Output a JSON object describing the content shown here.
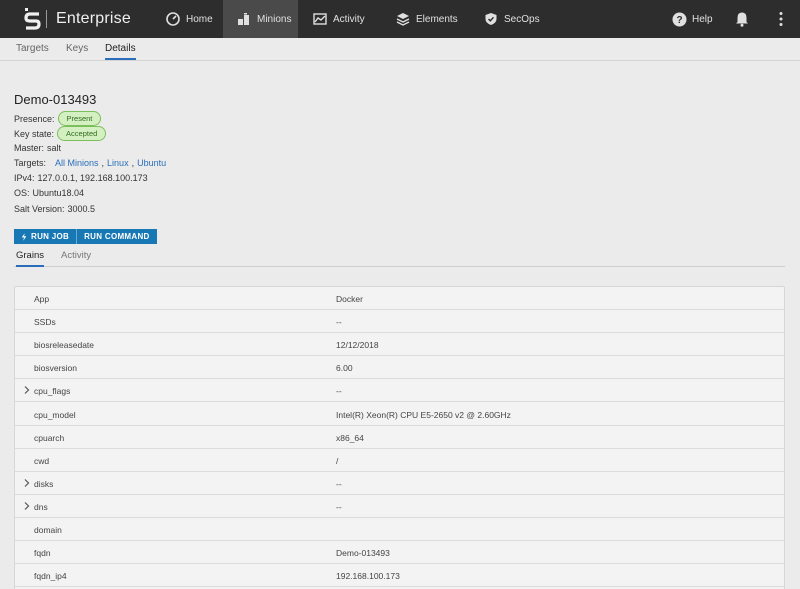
{
  "header": {
    "brand": "Enterprise",
    "nav": [
      {
        "label": "Home",
        "icon": "dashboard-icon"
      },
      {
        "label": "Minions",
        "icon": "minions-icon"
      },
      {
        "label": "Activity",
        "icon": "activity-icon"
      },
      {
        "label": "Elements",
        "icon": "layers-icon"
      },
      {
        "label": "SecOps",
        "icon": "shield-icon"
      }
    ],
    "help": "Help"
  },
  "subtabs": [
    "Targets",
    "Keys",
    "Details"
  ],
  "details": {
    "name": "Demo-013493",
    "presence_label": "Presence:",
    "presence": "Present",
    "keystate_label": "Key state:",
    "keystate": "Accepted",
    "master_label": "Master:",
    "master": "salt",
    "targets_label": "Targets:",
    "targets": [
      "All Minions",
      "Linux",
      "Ubuntu"
    ],
    "ipv4_label": "IPv4:",
    "ipv4": "127.0.0.1, 192.168.100.173",
    "os_label": "OS:",
    "os": "Ubuntu18.04",
    "salt_label": "Salt Version:",
    "salt_version": "3000.5"
  },
  "actions": {
    "run_job": "RUN JOB",
    "run_command": "RUN COMMAND"
  },
  "inner_tabs": [
    "Grains",
    "Activity"
  ],
  "grains": [
    {
      "key": "App",
      "value": "Docker",
      "expandable": false
    },
    {
      "key": "SSDs",
      "value": "--",
      "expandable": false
    },
    {
      "key": "biosreleasedate",
      "value": "12/12/2018",
      "expandable": false
    },
    {
      "key": "biosversion",
      "value": "6.00",
      "expandable": false
    },
    {
      "key": "cpu_flags",
      "value": "--",
      "expandable": true
    },
    {
      "key": "cpu_model",
      "value": "Intel(R) Xeon(R) CPU E5-2650 v2 @ 2.60GHz",
      "expandable": false
    },
    {
      "key": "cpuarch",
      "value": "x86_64",
      "expandable": false
    },
    {
      "key": "cwd",
      "value": "/",
      "expandable": false
    },
    {
      "key": "disks",
      "value": "--",
      "expandable": true
    },
    {
      "key": "dns",
      "value": "--",
      "expandable": true
    },
    {
      "key": "domain",
      "value": "",
      "expandable": false
    },
    {
      "key": "fqdn",
      "value": "Demo-013493",
      "expandable": false
    },
    {
      "key": "fqdn_ip4",
      "value": "192.168.100.173",
      "expandable": false
    },
    {
      "key": "",
      "value": "",
      "expandable": false
    }
  ],
  "colors": {
    "topbar": "#2d2d2d",
    "accent": "#1878b4",
    "badge_bg": "#d4f0c2",
    "link": "#2a6ebb"
  }
}
